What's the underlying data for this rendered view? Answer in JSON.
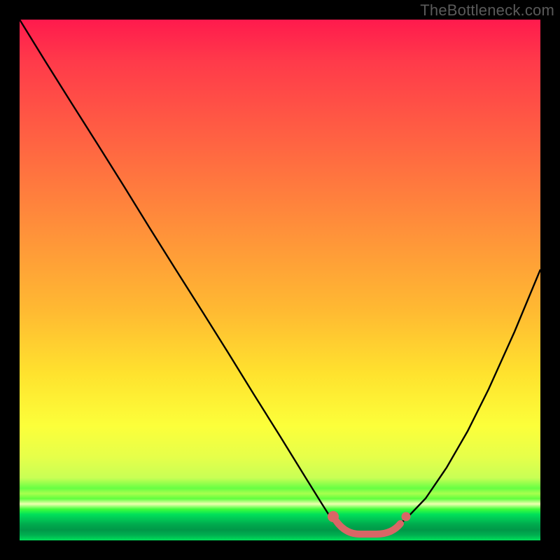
{
  "watermark": "TheBottleneck.com",
  "chart_data": {
    "type": "line",
    "title": "",
    "xlabel": "",
    "ylabel": "",
    "xlim": [
      0,
      100
    ],
    "ylim": [
      0,
      100
    ],
    "grid": false,
    "legend": false,
    "series": [
      {
        "name": "bottleneck-curve",
        "x": [
          0,
          5,
          10,
          15,
          20,
          25,
          30,
          35,
          40,
          45,
          50,
          55,
          58,
          60,
          62,
          65,
          68,
          70,
          72,
          75,
          78,
          82,
          86,
          90,
          95,
          100
        ],
        "y": [
          100,
          92,
          84,
          76,
          68,
          60,
          52,
          44,
          36,
          28,
          20,
          12,
          7,
          4,
          2,
          1,
          1,
          1,
          2,
          4,
          8,
          14,
          21,
          29,
          40,
          52
        ]
      }
    ],
    "markers": [
      {
        "name": "optimal-range-start",
        "x": 60,
        "y": 4,
        "r": 1.5
      },
      {
        "name": "optimal-range-bar",
        "x0": 62,
        "y0": 2,
        "x1": 72,
        "y1": 2
      },
      {
        "name": "optimal-range-end",
        "x": 74,
        "y": 4,
        "r": 1.2
      }
    ],
    "colors": {
      "curve": "#000000",
      "marker": "#d96666",
      "bg_top": "#ff1a4d",
      "bg_mid": "#ffe22e",
      "bg_bottom": "#00b050"
    }
  }
}
